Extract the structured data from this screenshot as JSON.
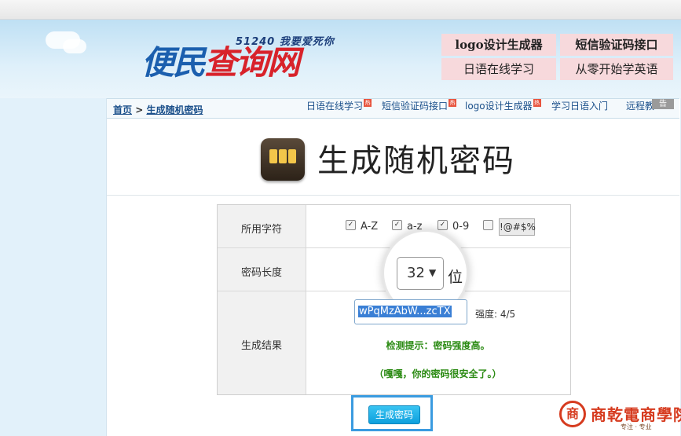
{
  "logo": {
    "main_part1": "便民",
    "main_part2": "查询网",
    "tagline": "51240 我要爱死你"
  },
  "topnav": [
    {
      "label": "logo设计生成器"
    },
    {
      "label": "短信验证码接口"
    },
    {
      "label": "日语在线学习"
    },
    {
      "label": "从零开始学英语"
    }
  ],
  "breadcrumb": {
    "home": "首页",
    "sep": " > ",
    "current": "生成随机密码"
  },
  "sublinks": [
    {
      "label": "日语在线学习",
      "hot": "热"
    },
    {
      "label": "短信验证码接口",
      "hot": "热"
    },
    {
      "label": "logo设计生成器",
      "hot": "热"
    },
    {
      "label": "学习日语入门"
    },
    {
      "label": "远程教"
    }
  ],
  "ad_tag": "告",
  "page": {
    "title": "生成随机密码"
  },
  "form": {
    "charset_label": "所用字符",
    "charsets": [
      {
        "label": "A-Z",
        "checked": true
      },
      {
        "label": "a-z",
        "checked": true
      },
      {
        "label": "0-9",
        "checked": true
      },
      {
        "label": "!@#$%",
        "checked": false
      }
    ],
    "length_label": "密码长度",
    "length_value": "32",
    "length_unit": "位",
    "result_label": "生成结果",
    "result_value": "wPqMzAbW...zcTX",
    "strength": "强度: 4/5",
    "tip1": "检测提示：密码强度高。",
    "tip2": "（嘎嘎，你的密码很安全了。）",
    "generate_button": "生成密码"
  },
  "watermark": {
    "icon": "商",
    "name": "商乾電商學院",
    "slogan": "专注 · 专业"
  }
}
